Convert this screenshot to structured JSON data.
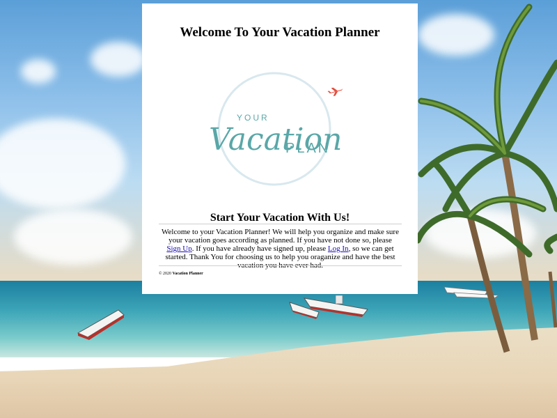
{
  "page": {
    "title": "Welcome To Your Vacation Planner",
    "logo": {
      "your": "YOUR",
      "vacation": "Vacation",
      "plan": "PLAN",
      "icon": "airplane-icon"
    },
    "section_title": "Start Your Vacation With Us!",
    "intro": {
      "part1": "Welcome to your Vacation Planner! We will help you organize and make sure your vacation goes according as planned. If you have not done so, please ",
      "signup_link": "Sign Up",
      "part2": ". If you have already have signed up, please ",
      "login_link": "Log In",
      "part3": ", so we can get started. Thank You for choosing us to help you oraganize and have the best vacation you have ever had."
    },
    "footer": {
      "copyright": "© 2020",
      "brand": "Vacation Planner"
    }
  },
  "colors": {
    "logo_teal": "#5aa7a8",
    "logo_circle": "#d8e8ee",
    "plane": "#e24b3b",
    "link": "#1a0dab"
  }
}
